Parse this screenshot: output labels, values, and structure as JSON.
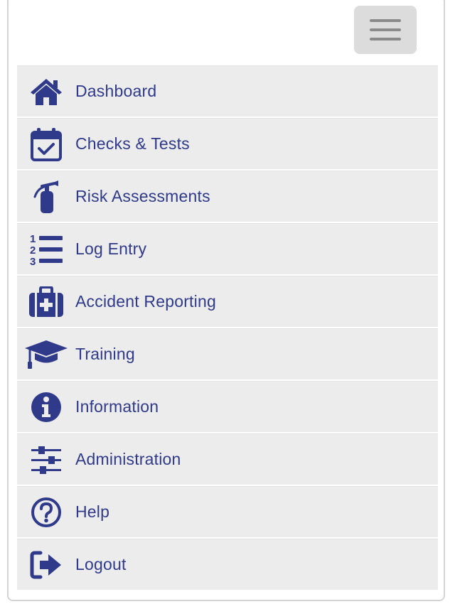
{
  "header": {
    "menu_toggle_icon": "hamburger-icon"
  },
  "colors": {
    "accent": "#2f3a8a",
    "item_background": "#ececec",
    "toggle_background": "#dcdcdc"
  },
  "nav": {
    "items": [
      {
        "label": "Dashboard",
        "icon": "home-icon"
      },
      {
        "label": "Checks & Tests",
        "icon": "calendar-check-icon"
      },
      {
        "label": "Risk Assessments",
        "icon": "fire-extinguisher-icon"
      },
      {
        "label": "Log Entry",
        "icon": "numbered-list-icon"
      },
      {
        "label": "Accident Reporting",
        "icon": "medkit-icon"
      },
      {
        "label": "Training",
        "icon": "graduation-cap-icon"
      },
      {
        "label": "Information",
        "icon": "info-circle-icon"
      },
      {
        "label": "Administration",
        "icon": "sliders-icon"
      },
      {
        "label": "Help",
        "icon": "question-circle-icon"
      },
      {
        "label": "Logout",
        "icon": "sign-out-icon"
      }
    ]
  }
}
